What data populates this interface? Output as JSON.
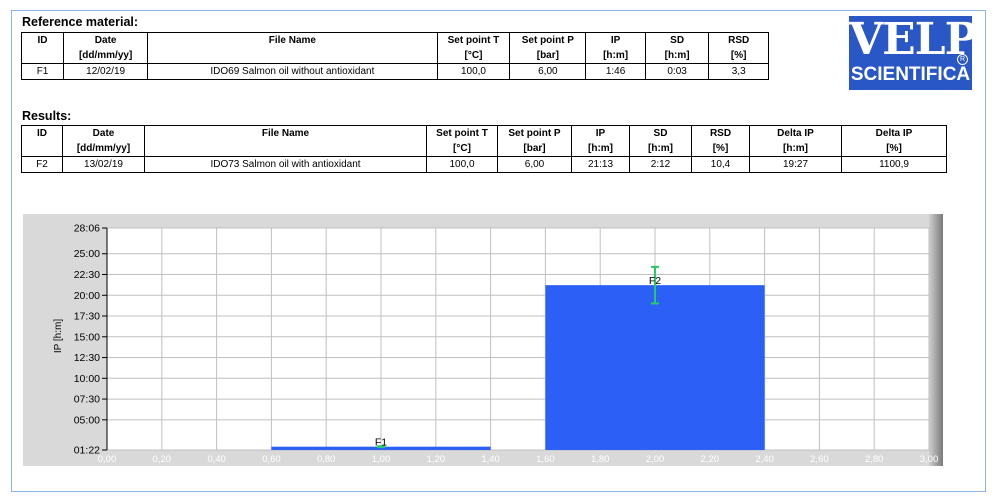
{
  "reference": {
    "title": "Reference material:",
    "headers_top": [
      "ID",
      "Date",
      "File Name",
      "Set point T",
      "Set point P",
      "IP",
      "SD",
      "RSD"
    ],
    "headers_unit": [
      "",
      "[dd/mm/yy]",
      "",
      "[°C]",
      "[bar]",
      "[h:m]",
      "[h:m]",
      "[%]"
    ],
    "row": [
      "F1",
      "12/02/19",
      "IDO69 Salmon oil without antioxidant",
      "100,0",
      "6,00",
      "1:46",
      "0:03",
      "3,3"
    ]
  },
  "results": {
    "title": "Results:",
    "headers_top": [
      "ID",
      "Date",
      "File Name",
      "Set point T",
      "Set point P",
      "IP",
      "SD",
      "RSD",
      "Delta IP",
      "Delta IP"
    ],
    "headers_unit": [
      "",
      "[dd/mm/yy]",
      "",
      "[°C]",
      "[bar]",
      "[h:m]",
      "[h:m]",
      "[%]",
      "[h:m]",
      "[%]"
    ],
    "row": [
      "F2",
      "13/02/19",
      "IDO73 Salmon oil with antioxidant",
      "100,0",
      "6,00",
      "21:13",
      "2:12",
      "10,4",
      "19:27",
      "1100,9"
    ]
  },
  "logo": {
    "line1": "VELP",
    "line2": "SCIENTIFICA",
    "reg": "R"
  },
  "chart_data": {
    "type": "bar",
    "ylabel": "IP [h:m]",
    "xlabel": "",
    "xlim": [
      0,
      3
    ],
    "ylim_minutes": [
      82,
      1686
    ],
    "x_ticks": [
      "0,00",
      "0,20",
      "0,40",
      "0,60",
      "0,80",
      "1,00",
      "1,20",
      "1,40",
      "1,60",
      "1,80",
      "2,00",
      "2,20",
      "2,40",
      "2,60",
      "2,80",
      "3,00"
    ],
    "y_ticks": [
      {
        "label": "01:22",
        "minutes": 82
      },
      {
        "label": "05:00",
        "minutes": 300
      },
      {
        "label": "07:30",
        "minutes": 450
      },
      {
        "label": "10:00",
        "minutes": 600
      },
      {
        "label": "12:30",
        "minutes": 750
      },
      {
        "label": "15:00",
        "minutes": 900
      },
      {
        "label": "17:30",
        "minutes": 1050
      },
      {
        "label": "20:00",
        "minutes": 1200
      },
      {
        "label": "22:30",
        "minutes": 1350
      },
      {
        "label": "25:00",
        "minutes": 1500
      },
      {
        "label": "28:06",
        "minutes": 1686
      }
    ],
    "bars": [
      {
        "label": "F1",
        "x_start": 0.6,
        "x_end": 1.4,
        "value": "1:46",
        "value_minutes": 106,
        "sd_minutes": 3
      },
      {
        "label": "F2",
        "x_start": 1.6,
        "x_end": 2.4,
        "value": "21:13",
        "value_minutes": 1273,
        "sd_minutes": 132
      }
    ],
    "grid": true,
    "colors": {
      "bar": "#2b5ff5",
      "error_bar": "#22cc66",
      "plot_bg": "#ffffff",
      "grid": "#c0c0c0",
      "panel": "#d9d9d9",
      "x_tick_text": "#ffffff"
    }
  }
}
